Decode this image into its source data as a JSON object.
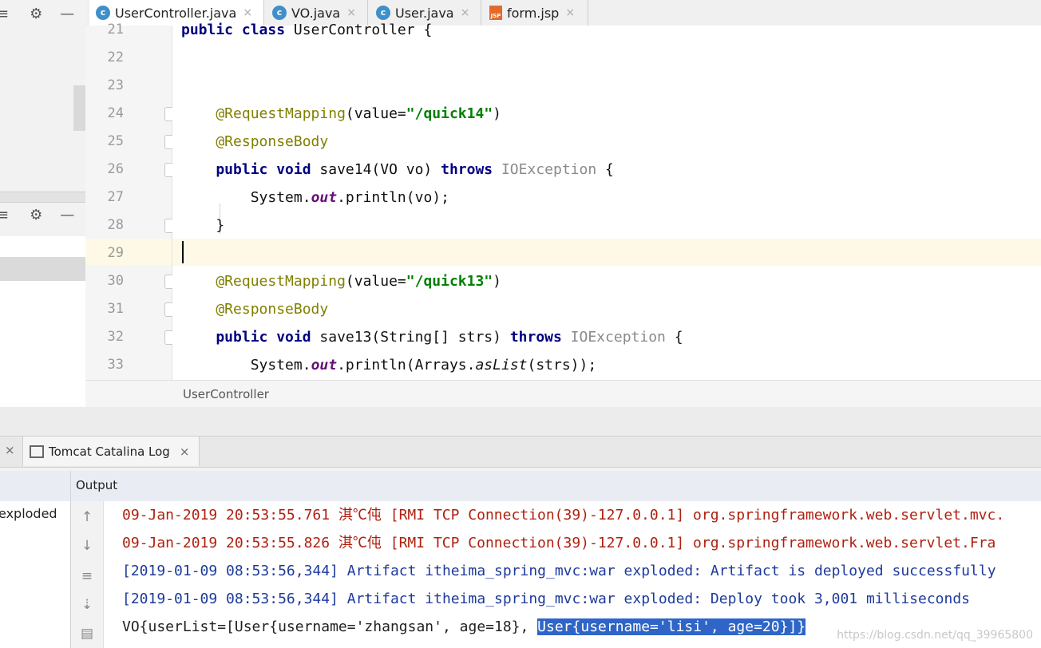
{
  "tabs": [
    {
      "label": "UserController.java",
      "icon": "c-class-icon",
      "active": true
    },
    {
      "label": "VO.java",
      "icon": "c-class-icon"
    },
    {
      "label": "User.java",
      "icon": "c-class-icon"
    },
    {
      "label": "form.jsp",
      "icon": "jsp-file-icon"
    }
  ],
  "icons": {
    "class_letter": "c",
    "jsp_text": "JSP",
    "close": "×"
  },
  "editor": {
    "lines": [
      {
        "num": "21",
        "segments": [
          {
            "t": "public class ",
            "c": "kw"
          },
          {
            "t": "UserController {",
            "c": ""
          }
        ]
      },
      {
        "num": "22",
        "segments": []
      },
      {
        "num": "23",
        "segments": []
      },
      {
        "num": "24",
        "segments": [
          {
            "t": "    @RequestMapping",
            "c": "ann"
          },
          {
            "t": "(value=",
            "c": ""
          },
          {
            "t": "\"/quick14\"",
            "c": "str"
          },
          {
            "t": ")",
            "c": ""
          }
        ]
      },
      {
        "num": "25",
        "segments": [
          {
            "t": "    @ResponseBody",
            "c": "ann"
          }
        ]
      },
      {
        "num": "26",
        "segments": [
          {
            "t": "    public void ",
            "c": "kw"
          },
          {
            "t": "save14(VO vo) ",
            "c": ""
          },
          {
            "t": "throws ",
            "c": "kw"
          },
          {
            "t": "IOException",
            "c": "gray"
          },
          {
            "t": " {",
            "c": ""
          }
        ]
      },
      {
        "num": "27",
        "segments": [
          {
            "t": "        System.",
            "c": ""
          },
          {
            "t": "out",
            "c": "ital"
          },
          {
            "t": ".println(vo);",
            "c": ""
          }
        ]
      },
      {
        "num": "28",
        "segments": [
          {
            "t": "    }",
            "c": ""
          }
        ]
      },
      {
        "num": "29",
        "segments": []
      },
      {
        "num": "30",
        "segments": [
          {
            "t": "    @RequestMapping",
            "c": "ann"
          },
          {
            "t": "(value=",
            "c": ""
          },
          {
            "t": "\"/quick13\"",
            "c": "str"
          },
          {
            "t": ")",
            "c": ""
          }
        ]
      },
      {
        "num": "31",
        "segments": [
          {
            "t": "    @ResponseBody",
            "c": "ann"
          }
        ]
      },
      {
        "num": "32",
        "segments": [
          {
            "t": "    public void ",
            "c": "kw"
          },
          {
            "t": "save13(String[] strs) ",
            "c": ""
          },
          {
            "t": "throws ",
            "c": "kw"
          },
          {
            "t": "IOException",
            "c": "gray"
          },
          {
            "t": " {",
            "c": ""
          }
        ]
      },
      {
        "num": "33",
        "segments": [
          {
            "t": "        System.",
            "c": ""
          },
          {
            "t": "out",
            "c": "ital"
          },
          {
            "t": ".println(Arrays.",
            "c": ""
          },
          {
            "t": "asList",
            "c": "italn"
          },
          {
            "t": "(strs));",
            "c": ""
          }
        ]
      }
    ]
  },
  "breadcrumb": "UserController",
  "run_tab": {
    "label": "Tomcat Catalina Log",
    "close": "×"
  },
  "output": {
    "header": "Output",
    "left_item": "exploded",
    "lines": [
      {
        "cls": "red",
        "text": "09-Jan-2019 20:53:55.761 淇℃伅 [RMI TCP Connection(39)-127.0.0.1] org.springframework.web.servlet.mvc."
      },
      {
        "cls": "red",
        "text": "09-Jan-2019 20:53:55.826 淇℃伅 [RMI TCP Connection(39)-127.0.0.1] org.springframework.web.servlet.Fra"
      },
      {
        "cls": "blue",
        "text": "[2019-01-09 08:53:56,344] Artifact itheima_spring_mvc:war exploded: Artifact is deployed successfully"
      },
      {
        "cls": "blue",
        "text": "[2019-01-09 08:53:56,344] Artifact itheima_spring_mvc:war exploded: Deploy took 3,001 milliseconds"
      }
    ],
    "last_line_plain": "VO{userList=[User{username='zhangsan', age=18}, ",
    "last_line_selected": "User{username='lisi', age=20}]}"
  },
  "watermark": "https://blog.csdn.net/qq_39965800"
}
